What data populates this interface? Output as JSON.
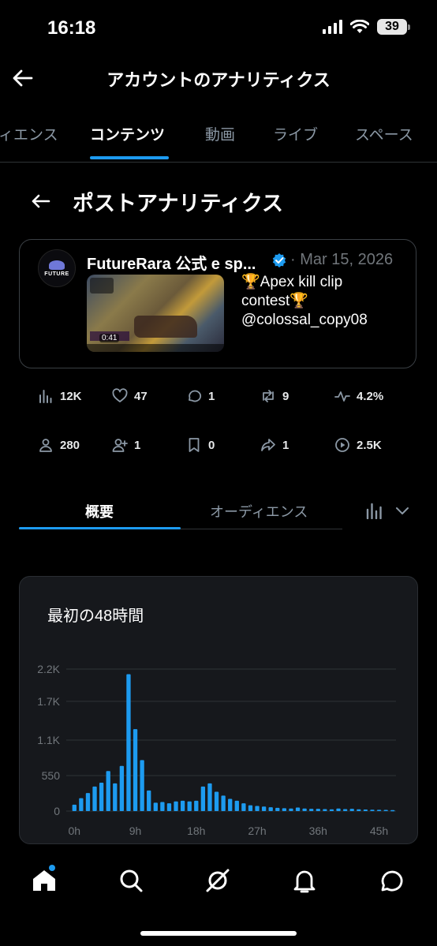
{
  "status_bar": {
    "time": "16:18",
    "battery": "39"
  },
  "header": {
    "title": "アカウントのアナリティクス"
  },
  "top_tabs": [
    {
      "label": "ィエンス"
    },
    {
      "label": "コンテンツ",
      "active": true
    },
    {
      "label": "動画"
    },
    {
      "label": "ライブ"
    },
    {
      "label": "スペース"
    }
  ],
  "section": {
    "title": "ポストアナリティクス"
  },
  "post": {
    "author": "FutureRara 公式 e sp...",
    "separator": "·",
    "date": "Mar 15, 2026",
    "avatar_text": "FUTURE",
    "video_duration": "0:41",
    "text_line1": "🏆Apex kill clip",
    "text_line2": "contest🏆",
    "text_line3": "@colossal_copy08"
  },
  "metrics_row1": [
    {
      "icon": "impressions-icon",
      "value": "12K"
    },
    {
      "icon": "heart-icon",
      "value": "47"
    },
    {
      "icon": "reply-icon",
      "value": "1"
    },
    {
      "icon": "repost-icon",
      "value": "9"
    },
    {
      "icon": "engagement-rate-icon",
      "value": "4.2%"
    }
  ],
  "metrics_row2": [
    {
      "icon": "profile-visits-icon",
      "value": "280"
    },
    {
      "icon": "new-follows-icon",
      "value": "1"
    },
    {
      "icon": "bookmark-icon",
      "value": "0"
    },
    {
      "icon": "share-icon",
      "value": "1"
    },
    {
      "icon": "video-views-icon",
      "value": "2.5K"
    }
  ],
  "sub_tabs": [
    {
      "label": "概要",
      "active": true
    },
    {
      "label": "オーディエンス"
    }
  ],
  "chart_title": "最初の48時間",
  "chart_data": {
    "type": "bar",
    "title": "最初の48時間",
    "color": "#1d9bf0",
    "y_ticks": [
      0,
      550,
      1100,
      1700,
      2200
    ],
    "y_tick_labels": [
      "0",
      "550",
      "1.1K",
      "1.7K",
      "2.2K"
    ],
    "x_tick_labels": [
      "0h",
      "9h",
      "18h",
      "27h",
      "36h",
      "45h"
    ],
    "x_tick_positions": [
      0,
      9,
      18,
      27,
      36,
      45
    ],
    "ylim": [
      0,
      2200
    ],
    "x": [
      0,
      1,
      2,
      3,
      4,
      5,
      6,
      7,
      8,
      9,
      10,
      11,
      12,
      13,
      14,
      15,
      16,
      17,
      18,
      19,
      20,
      21,
      22,
      23,
      24,
      25,
      26,
      27,
      28,
      29,
      30,
      31,
      32,
      33,
      34,
      35,
      36,
      37,
      38,
      39,
      40,
      41,
      42,
      43,
      44,
      45,
      46,
      47
    ],
    "values": [
      100,
      200,
      280,
      380,
      440,
      620,
      430,
      700,
      2120,
      1270,
      790,
      320,
      130,
      140,
      120,
      150,
      160,
      150,
      160,
      380,
      430,
      300,
      240,
      190,
      160,
      120,
      90,
      80,
      70,
      60,
      50,
      45,
      40,
      55,
      40,
      35,
      35,
      30,
      28,
      40,
      30,
      35,
      28,
      25,
      22,
      20,
      18,
      15
    ]
  },
  "bottom_nav": [
    {
      "icon": "home-icon"
    },
    {
      "icon": "search-icon"
    },
    {
      "icon": "grok-icon"
    },
    {
      "icon": "notifications-icon"
    },
    {
      "icon": "messages-icon"
    }
  ]
}
